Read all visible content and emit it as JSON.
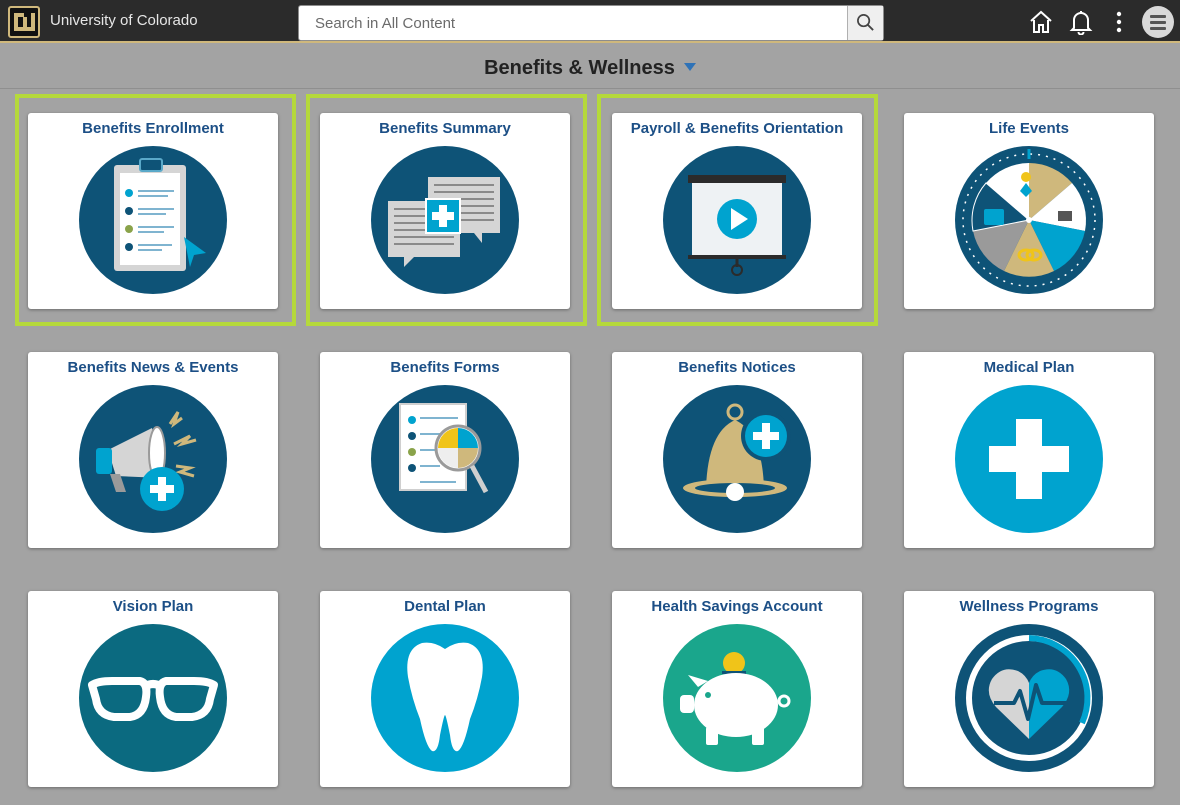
{
  "header": {
    "org_name": "University of Colorado",
    "search_placeholder": "Search in All Content",
    "search_value": ""
  },
  "page": {
    "title": "Benefits & Wellness"
  },
  "colors": {
    "highlight": "#b5d93b",
    "tile_label": "#1c4f86",
    "navy_circle": "#0e5377",
    "cyan_circle": "#00a3cf",
    "teal_circle": "#0b6a80",
    "green_circle": "#1aa68c",
    "gold": "#cfb87c"
  },
  "tiles": [
    {
      "label": "Benefits Enrollment",
      "icon": "clipboard-icon",
      "highlighted": true
    },
    {
      "label": "Benefits Summary",
      "icon": "chat-bubbles-icon",
      "highlighted": true
    },
    {
      "label": "Payroll & Benefits Orientation",
      "icon": "presentation-video-icon",
      "highlighted": true
    },
    {
      "label": "Life Events",
      "icon": "life-events-wheel-icon",
      "highlighted": false
    },
    {
      "label": "Benefits News & Events",
      "icon": "megaphone-icon",
      "highlighted": false
    },
    {
      "label": "Benefits Forms",
      "icon": "forms-magnifier-icon",
      "highlighted": false
    },
    {
      "label": "Benefits Notices",
      "icon": "bell-icon",
      "highlighted": false
    },
    {
      "label": "Medical Plan",
      "icon": "medical-cross-icon",
      "highlighted": false
    },
    {
      "label": "Vision Plan",
      "icon": "glasses-icon",
      "highlighted": false
    },
    {
      "label": "Dental Plan",
      "icon": "tooth-icon",
      "highlighted": false
    },
    {
      "label": "Health Savings Account",
      "icon": "piggy-bank-icon",
      "highlighted": false
    },
    {
      "label": "Wellness Programs",
      "icon": "heart-pulse-icon",
      "highlighted": false
    }
  ]
}
